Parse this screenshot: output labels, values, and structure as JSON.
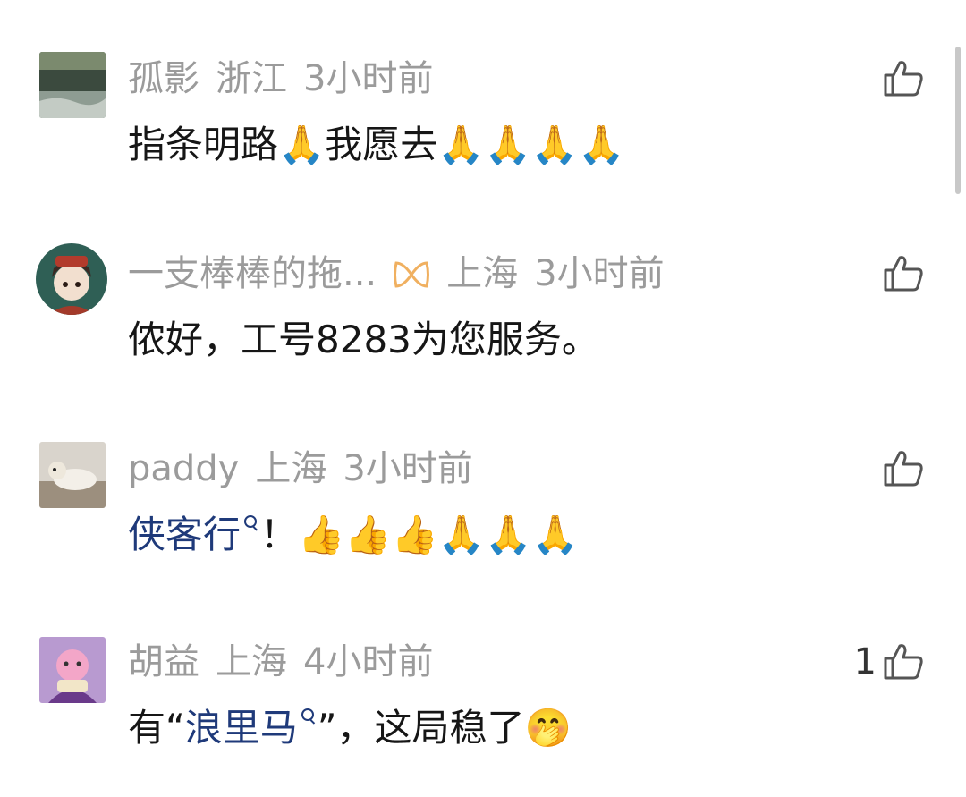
{
  "comments": [
    {
      "author": "孤影",
      "location": "浙江",
      "time": "3小时前",
      "text": "指条明路🙏我愿去🙏🙏🙏🙏",
      "likes": ""
    },
    {
      "author": "一支棒棒的拖...",
      "location": "上海",
      "time": "3小时前",
      "text": "侬好，工号8283为您服务。",
      "likes": ""
    },
    {
      "author": "paddy",
      "location": "上海",
      "time": "3小时前",
      "link_text": "侠客行",
      "text_after": "！👍👍👍🙏🙏🙏",
      "likes": ""
    },
    {
      "author": "胡益",
      "location": "上海",
      "time": "4小时前",
      "text_before": "有“",
      "link_text": "浪里马",
      "text_after": "”，这局稳了🤭",
      "likes": "1"
    }
  ],
  "colors": {
    "meta": "#9b9b9b",
    "body": "#161616",
    "link": "#1f3a7a",
    "badge": "#f0b060"
  },
  "icons": {
    "like": "thumbs-up-outline-icon",
    "badge": "orange-bow-icon",
    "search": "search-small-icon"
  }
}
